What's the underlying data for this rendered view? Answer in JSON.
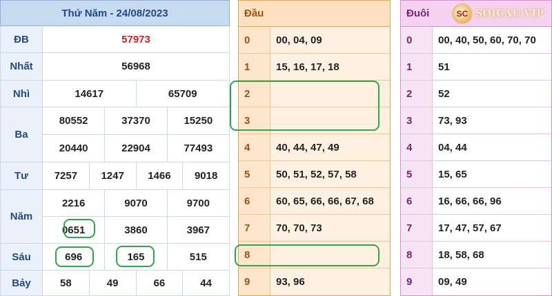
{
  "results": {
    "header": "Thứ Năm - 24/08/2023",
    "rows": [
      {
        "label": "ĐB",
        "values": [
          "57973"
        ]
      },
      {
        "label": "Nhất",
        "values": [
          "56968"
        ]
      },
      {
        "label": "Nhì",
        "values": [
          "14617",
          "65709"
        ]
      },
      {
        "label": "Ba",
        "values": [
          "80552",
          "37370",
          "15250",
          "20440",
          "22904",
          "77493"
        ]
      },
      {
        "label": "Tư",
        "values": [
          "7257",
          "1247",
          "1466",
          "9018"
        ]
      },
      {
        "label": "Năm",
        "values": [
          "2216",
          "9070",
          "9700",
          "0651",
          "3860",
          "3967"
        ]
      },
      {
        "label": "Sáu",
        "values": [
          "696",
          "165",
          "515"
        ]
      },
      {
        "label": "Bảy",
        "values": [
          "58",
          "49",
          "66",
          "44"
        ]
      }
    ]
  },
  "dau": {
    "header": "Đầu",
    "rows": [
      {
        "key": "0",
        "values": "00, 04, 09"
      },
      {
        "key": "1",
        "values": "15, 16, 17, 18"
      },
      {
        "key": "2",
        "values": ""
      },
      {
        "key": "3",
        "values": ""
      },
      {
        "key": "4",
        "values": "40, 44, 47, 49"
      },
      {
        "key": "5",
        "values": "50, 51, 52, 57, 58"
      },
      {
        "key": "6",
        "values": "60, 65, 66, 66, 67, 68"
      },
      {
        "key": "7",
        "values": "70, 70, 73"
      },
      {
        "key": "8",
        "values": ""
      },
      {
        "key": "9",
        "values": "93, 96"
      }
    ]
  },
  "duoi": {
    "header": "Đuôi",
    "rows": [
      {
        "key": "0",
        "values": "00, 40, 50, 60, 70, 70"
      },
      {
        "key": "1",
        "values": "51"
      },
      {
        "key": "2",
        "values": "52"
      },
      {
        "key": "3",
        "values": "73, 93"
      },
      {
        "key": "4",
        "values": "04, 44"
      },
      {
        "key": "5",
        "values": "15, 65"
      },
      {
        "key": "6",
        "values": "16, 66, 66, 96"
      },
      {
        "key": "7",
        "values": "17, 47, 57, 67"
      },
      {
        "key": "8",
        "values": "18, 58, 68"
      },
      {
        "key": "9",
        "values": "09, 49"
      }
    ]
  },
  "logo": {
    "text": "SOICAU.VIP",
    "badge": "SC"
  },
  "colors": {
    "special_prize": "#e01e1e",
    "highlight_ring": "#2aa84a"
  }
}
